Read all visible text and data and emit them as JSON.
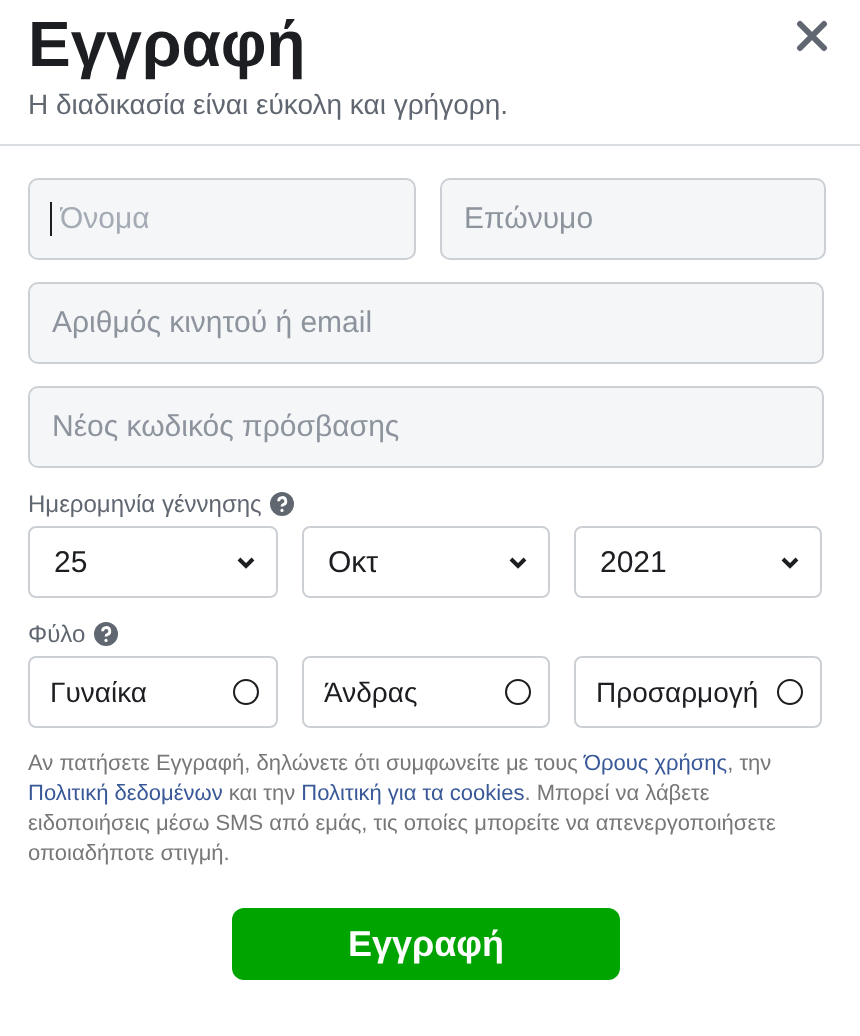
{
  "header": {
    "title": "Εγγραφή",
    "subtitle": "Η διαδικασία είναι εύκολη και γρήγορη."
  },
  "name_fields": [
    {
      "placeholder": "Όνομα",
      "focused": true
    },
    {
      "placeholder": "Επώνυμο",
      "focused": false
    }
  ],
  "fields": [
    {
      "placeholder": "Αριθμός κινητού ή email"
    },
    {
      "placeholder": "Νέος κωδικός πρόσβασης"
    }
  ],
  "birthday": {
    "label": "Ημερομηνία γέννησης",
    "selects": [
      {
        "value": "25"
      },
      {
        "value": "Οκτ"
      },
      {
        "value": "2021"
      }
    ]
  },
  "gender": {
    "label": "Φύλο",
    "options": [
      {
        "label": "Γυναίκα",
        "selected": false
      },
      {
        "label": "Άνδρας",
        "selected": false
      },
      {
        "label": "Προσαρμογή",
        "selected": false
      }
    ]
  },
  "terms": [
    {
      "kind": "text",
      "text": "Αν πατήσετε Εγγραφή, δηλώνετε ότι συμφωνείτε με τους "
    },
    {
      "kind": "link",
      "text": "Όρους χρήσης"
    },
    {
      "kind": "text",
      "text": ", την "
    },
    {
      "kind": "link",
      "text": "Πολιτική δεδομένων"
    },
    {
      "kind": "text",
      "text": " και την "
    },
    {
      "kind": "link",
      "text": "Πολιτική για τα cookies"
    },
    {
      "kind": "text",
      "text": ". Μπορεί να λάβετε ειδοποιήσεις μέσω SMS από εμάς, τις οποίες μπορείτε να απενεργοποιήσετε οποιαδήποτε στιγμή."
    }
  ],
  "submit": "Εγγραφή"
}
